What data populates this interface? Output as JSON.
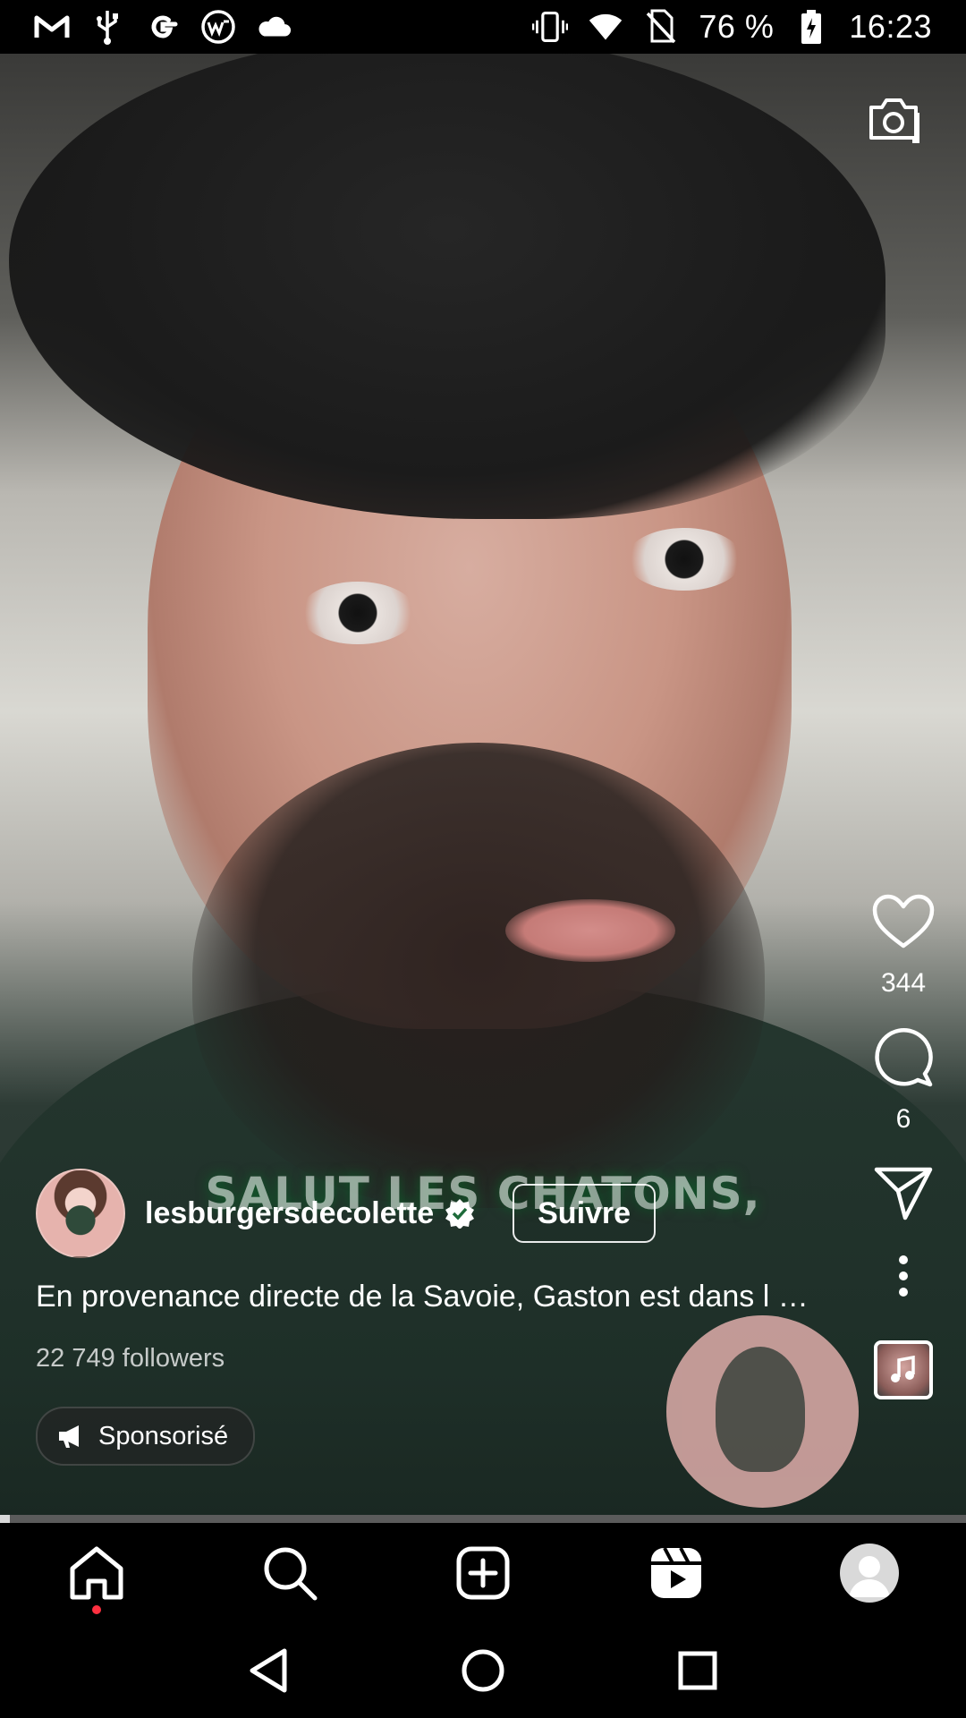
{
  "status_bar": {
    "battery": "76 %",
    "time": "16:23",
    "left_icons": [
      "gmail-icon",
      "usb-icon",
      "google-icon",
      "webtoon-icon",
      "cloud-icon"
    ],
    "right_icons": [
      "vibrate-icon",
      "wifi-icon",
      "no-sim-icon",
      "battery-charging-icon"
    ]
  },
  "reel": {
    "subtitle_overlay": "SALUT LES CHATONS,",
    "author": {
      "username": "lesburgersdecolette",
      "verified": true,
      "follow_label": "Suivre"
    },
    "caption": "En provenance directe de la Savoie, Gaston est dans l …",
    "followers": "22 749 followers",
    "sponsored_label": "Sponsorisé",
    "progress": 0.01
  },
  "actions": {
    "likes": "344",
    "comments": "6"
  },
  "icons": {
    "camera": "camera-icon",
    "like": "heart-icon",
    "comment": "comment-bubble-icon",
    "share": "paper-plane-icon",
    "more": "more-vertical-icon",
    "music": "music-note-icon",
    "sponsored": "megaphone-icon"
  },
  "bottom_nav": {
    "items": [
      "home-icon",
      "search-icon",
      "create-post-icon",
      "reels-icon",
      "profile-avatar"
    ]
  },
  "system_nav": {
    "items": [
      "back-icon",
      "home-circle-icon",
      "recents-icon"
    ]
  },
  "colors": {
    "background": "#000000",
    "notification_dot": "#ff3040",
    "progress_track": "#5b5b5b",
    "progress_fill": "#d8d8d8"
  }
}
